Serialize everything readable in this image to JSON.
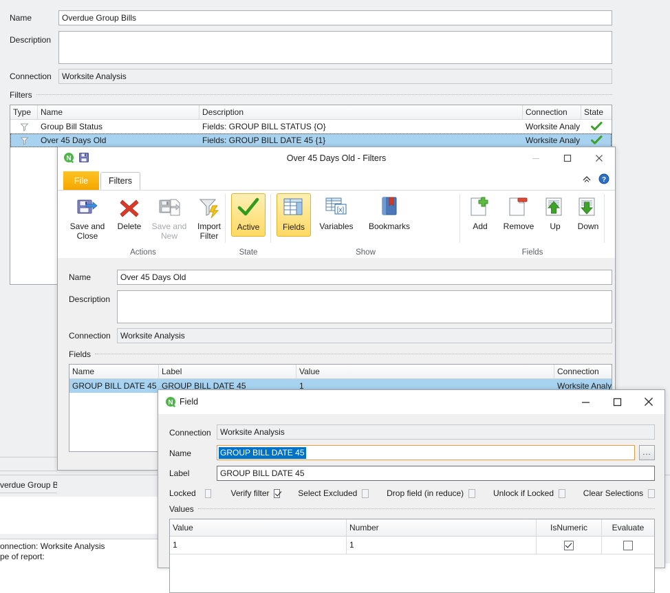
{
  "report_window": {
    "fields": [
      {
        "label": "Name",
        "value": "Overdue Group Bills"
      },
      {
        "label": "Description",
        "value": ""
      },
      {
        "label": "Connection",
        "value": "Worksite Analysis"
      }
    ],
    "filters_group_label": "Filters",
    "filters_table": {
      "columns": [
        "Type",
        "Name",
        "Description",
        "Connection",
        "State"
      ],
      "rows": [
        {
          "type_icon": "funnel-icon",
          "name": "Group Bill Status",
          "description": "Fields: GROUP BILL STATUS {O}",
          "connection": "Worksite Analy",
          "state_icon": "green-check-icon",
          "selected": false
        },
        {
          "type_icon": "funnel-icon",
          "name": "Over 45 Days Old",
          "description": "Fields: GROUP BILL DATE 45 {1}",
          "connection": "Worksite Analy",
          "state_icon": "green-check-icon",
          "selected": true
        }
      ]
    },
    "clipped_row_text": "verdue Group Bil",
    "preview_lines": [
      "onnection: Worksite Analysis",
      "pe of report:"
    ]
  },
  "filters_window": {
    "title": "Over 45 Days Old - Filters",
    "app_icon": "qlik-n-icon",
    "quick_access": [
      "save-icon"
    ],
    "window_buttons": {
      "minimize": "minimize-icon",
      "maximize": "maximize-icon",
      "close": "close-icon"
    },
    "tabs": [
      {
        "label": "File",
        "active": false
      },
      {
        "label": "Filters",
        "active": true
      }
    ],
    "help_icons": [
      "collapse-ribbon-icon",
      "help-icon"
    ],
    "ribbon_groups": [
      {
        "name": "Actions",
        "buttons": [
          {
            "label": "Save and\nClose",
            "icon": "save-and-close-icon",
            "disabled": false,
            "toggled": false
          },
          {
            "label": "Delete",
            "icon": "delete-x-icon",
            "disabled": false,
            "toggled": false
          },
          {
            "label": "Save and\nNew",
            "icon": "save-and-new-icon",
            "disabled": true,
            "toggled": false
          },
          {
            "label": "Import\nFilter",
            "icon": "import-filter-icon",
            "disabled": false,
            "toggled": false
          }
        ]
      },
      {
        "name": "State",
        "buttons": [
          {
            "label": "Active",
            "icon": "green-check-icon",
            "disabled": false,
            "toggled": true
          }
        ]
      },
      {
        "name": "Show",
        "buttons": [
          {
            "label": "Fields",
            "icon": "fields-table-icon",
            "disabled": false,
            "toggled": true
          },
          {
            "label": "Variables",
            "icon": "variables-icon",
            "disabled": false,
            "toggled": false
          },
          {
            "label": "Bookmarks",
            "icon": "bookmarks-icon",
            "disabled": false,
            "toggled": false
          }
        ]
      },
      {
        "name": "Fields",
        "buttons": [
          {
            "label": "Add",
            "icon": "add-page-icon",
            "disabled": false,
            "toggled": false
          },
          {
            "label": "Remove",
            "icon": "remove-page-icon",
            "disabled": false,
            "toggled": false
          },
          {
            "label": "Up",
            "icon": "move-up-icon",
            "disabled": false,
            "toggled": false
          },
          {
            "label": "Down",
            "icon": "move-down-icon",
            "disabled": false,
            "toggled": false
          }
        ]
      }
    ],
    "form": {
      "name_label": "Name",
      "name_value": "Over 45 Days Old",
      "description_label": "Description",
      "description_value": "",
      "connection_label": "Connection",
      "connection_value": "Worksite Analysis",
      "fields_group_label": "Fields"
    },
    "fields_table": {
      "columns": [
        "Name",
        "Label",
        "Value",
        "Connection"
      ],
      "rows": [
        {
          "name": "GROUP BILL DATE 45",
          "label": "GROUP BILL DATE 45",
          "value": "1",
          "connection": "Worksite Analy",
          "selected": true
        }
      ]
    }
  },
  "field_dialog": {
    "title": "Field",
    "app_icon": "qlik-n-icon",
    "window_buttons": {
      "minimize": "minimize-icon",
      "maximize": "maximize-icon",
      "close": "close-icon"
    },
    "connection_label": "Connection",
    "connection_value": "Worksite Analysis",
    "name_label": "Name",
    "name_value": "GROUP BILL DATE 45",
    "name_selected": true,
    "browse_button_label": "...",
    "label_label": "Label",
    "label_value": "GROUP BILL DATE 45",
    "checkboxes": [
      {
        "label": "Locked",
        "checked": false,
        "label_side": "left"
      },
      {
        "label": "Verify filter",
        "checked": true,
        "label_side": "left"
      },
      {
        "label": "Select Excluded",
        "checked": false,
        "label_side": "left"
      },
      {
        "label": "Drop field (in reduce)",
        "checked": false,
        "label_side": "left"
      },
      {
        "label": "Unlock if Locked",
        "checked": false,
        "label_side": "left"
      },
      {
        "label": "Clear Selections",
        "checked": false,
        "label_side": "left"
      }
    ],
    "values_group_label": "Values",
    "values_table": {
      "columns": [
        "Value",
        "Number",
        "IsNumeric",
        "Evaluate"
      ],
      "rows": [
        {
          "value": "1",
          "number": "1",
          "isnumeric": true,
          "evaluate": false
        }
      ]
    }
  },
  "colors": {
    "selection_blue": "#a8d3f0",
    "text_select_blue": "#0072c6",
    "ribbon_toggle_yellow": "#ffd964",
    "file_tab_orange": "#ffb900",
    "green_check": "#3fa32b",
    "window_bg": "#f0f0f0"
  }
}
